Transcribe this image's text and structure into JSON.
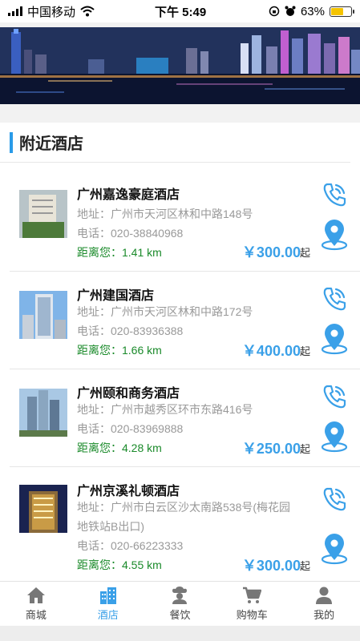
{
  "status_bar": {
    "carrier": "中国移动",
    "time": "下午 5:49",
    "battery_text": "63%",
    "battery_level": 0.63
  },
  "section": {
    "title": "附近酒店"
  },
  "hotels": [
    {
      "name": "广州嘉逸豪庭酒店",
      "address": "地址：广州市天河区林和中路148号",
      "phone": "电话：020-38840968",
      "distance": "距离您：1.41 km",
      "price": "￥300.00",
      "price_suffix": "起"
    },
    {
      "name": "广州建国酒店",
      "address": "地址：广州市天河区林和中路172号",
      "phone": "电话：020-83936388",
      "distance": "距离您：1.66 km",
      "price": "￥400.00",
      "price_suffix": "起"
    },
    {
      "name": "广州颐和商务酒店",
      "address": "地址：广州市越秀区环市东路416号",
      "phone": "电话：020-83969888",
      "distance": "距离您：4.28 km",
      "price": "￥250.00",
      "price_suffix": "起"
    },
    {
      "name": "广州京溪礼顿酒店",
      "address_line1": "地址：广州市白云区沙太南路538号(梅花园",
      "address_line2": "地铁站B出口)",
      "phone": "电话：020-66223333",
      "distance": "距离您：4.55 km",
      "price": "￥300.00",
      "price_suffix": "起"
    }
  ],
  "tabs": [
    {
      "label": "商城",
      "icon": "home-icon"
    },
    {
      "label": "酒店",
      "icon": "hotel-building-icon",
      "active": true
    },
    {
      "label": "餐饮",
      "icon": "chef-icon"
    },
    {
      "label": "购物车",
      "icon": "cart-icon"
    },
    {
      "label": "我的",
      "icon": "user-icon"
    }
  ],
  "colors": {
    "accent": "#3aa0e8",
    "distance": "#1a8a2a",
    "section_bar": "#2a9be8",
    "battery": "#f5c400"
  }
}
